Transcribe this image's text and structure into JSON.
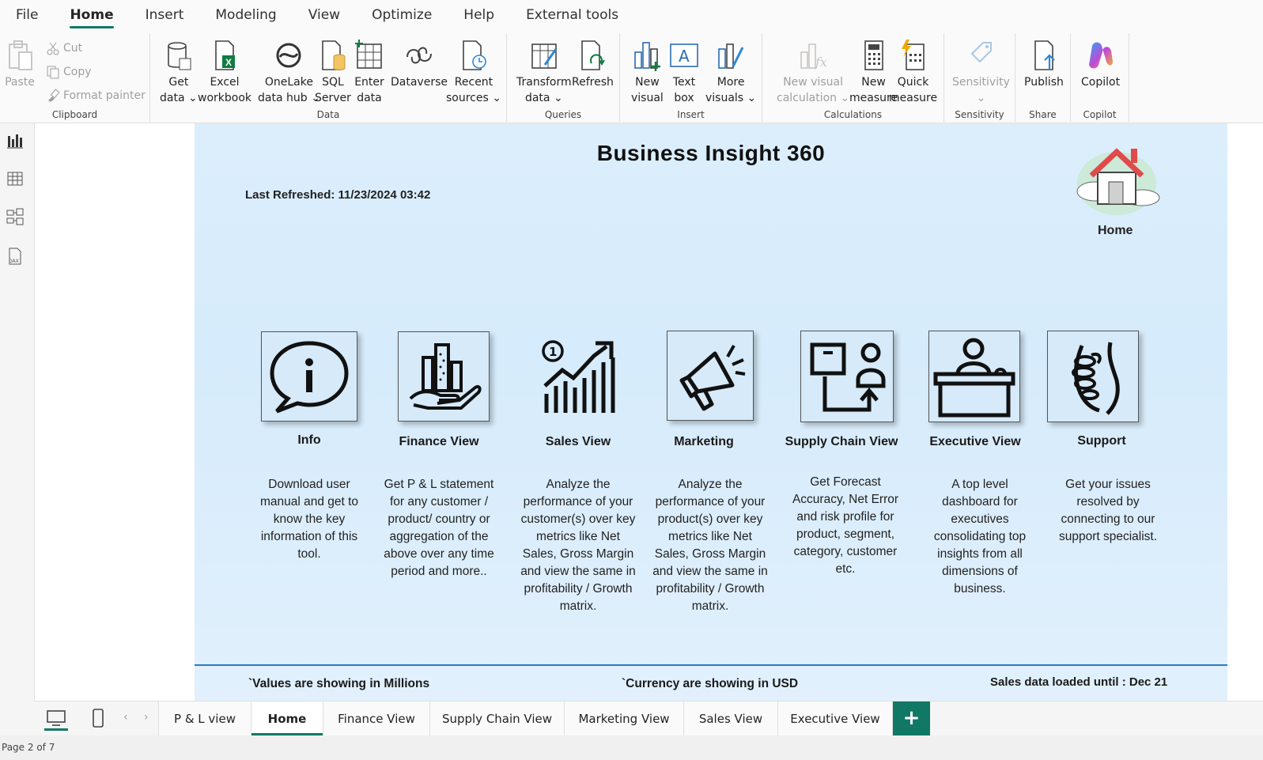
{
  "menu": [
    "File",
    "Home",
    "Insert",
    "Modeling",
    "View",
    "Optimize",
    "Help",
    "External tools"
  ],
  "ribbon": {
    "clipboard": {
      "paste": "Paste",
      "cut": "Cut",
      "copy": "Copy",
      "format_painter": "Format painter",
      "label": "Clipboard"
    },
    "data": {
      "get_data": "Get\ndata ⌄",
      "excel": "Excel\nworkbook",
      "onelake": "OneLake\ndata hub ⌄",
      "sql": "SQL\nServer",
      "enter": "Enter\ndata",
      "dataverse": "Dataverse",
      "recent": "Recent\nsources ⌄",
      "label": "Data"
    },
    "queries": {
      "transform": "Transform\ndata ⌄",
      "refresh": "Refresh",
      "label": "Queries"
    },
    "insert": {
      "new_visual": "New\nvisual",
      "text_box": "Text\nbox",
      "more_visuals": "More\nvisuals ⌄",
      "label": "Insert"
    },
    "calculations": {
      "new_visual_calc": "New visual\ncalculation ⌄",
      "new_measure": "New\nmeasure",
      "quick_measure": "Quick\nmeasure",
      "label": "Calculations"
    },
    "sensitivity": {
      "btn": "Sensitivity\n⌄",
      "label": "Sensitivity"
    },
    "share": {
      "publish": "Publish",
      "label": "Share"
    },
    "copilot": {
      "btn": "Copilot",
      "label": "Copilot"
    }
  },
  "report": {
    "title": "Business Insight 360",
    "last_refreshed": "Last Refreshed: 11/23/2024 03:42",
    "home_label": "Home",
    "cards": [
      {
        "title": "Info",
        "desc": "Download user manual and get to know the key information of this tool."
      },
      {
        "title": "Finance View",
        "desc": "Get P & L statement for any customer / product/ country or aggregation of the above over any time period and more.."
      },
      {
        "title": "Sales View",
        "desc": "Analyze the performance of your customer(s) over key metrics like Net Sales, Gross Margin and view the same in profitability / Growth matrix."
      },
      {
        "title": "Marketing",
        "desc": "Analyze the performance of your product(s) over key metrics like Net Sales, Gross Margin and view the same in profitability / Growth matrix."
      },
      {
        "title": "Supply Chain View",
        "desc": "Get Forecast Accuracy, Net Error and risk profile for product, segment, category, customer etc."
      },
      {
        "title": "Executive View",
        "desc": "A top level dashboard for executives consolidating top insights from all dimensions of business."
      },
      {
        "title": "Support",
        "desc": "Get your issues resolved by connecting to our support specialist."
      }
    ],
    "footer_values": "`Values are showing in Millions",
    "footer_currency": "`Currency are showing in USD",
    "footer_sales": "Sales data loaded until : Dec 21"
  },
  "tabs": [
    "P & L view",
    "Home",
    "Finance View",
    "Supply Chain View",
    "Marketing View",
    "Sales View",
    "Executive View"
  ],
  "active_tab": "Home",
  "add_tab": "+",
  "status": "Page 2 of 7",
  "colors": {
    "accent": "#117865",
    "page_bg": "#dceefc",
    "rule": "#2a7bc8"
  }
}
